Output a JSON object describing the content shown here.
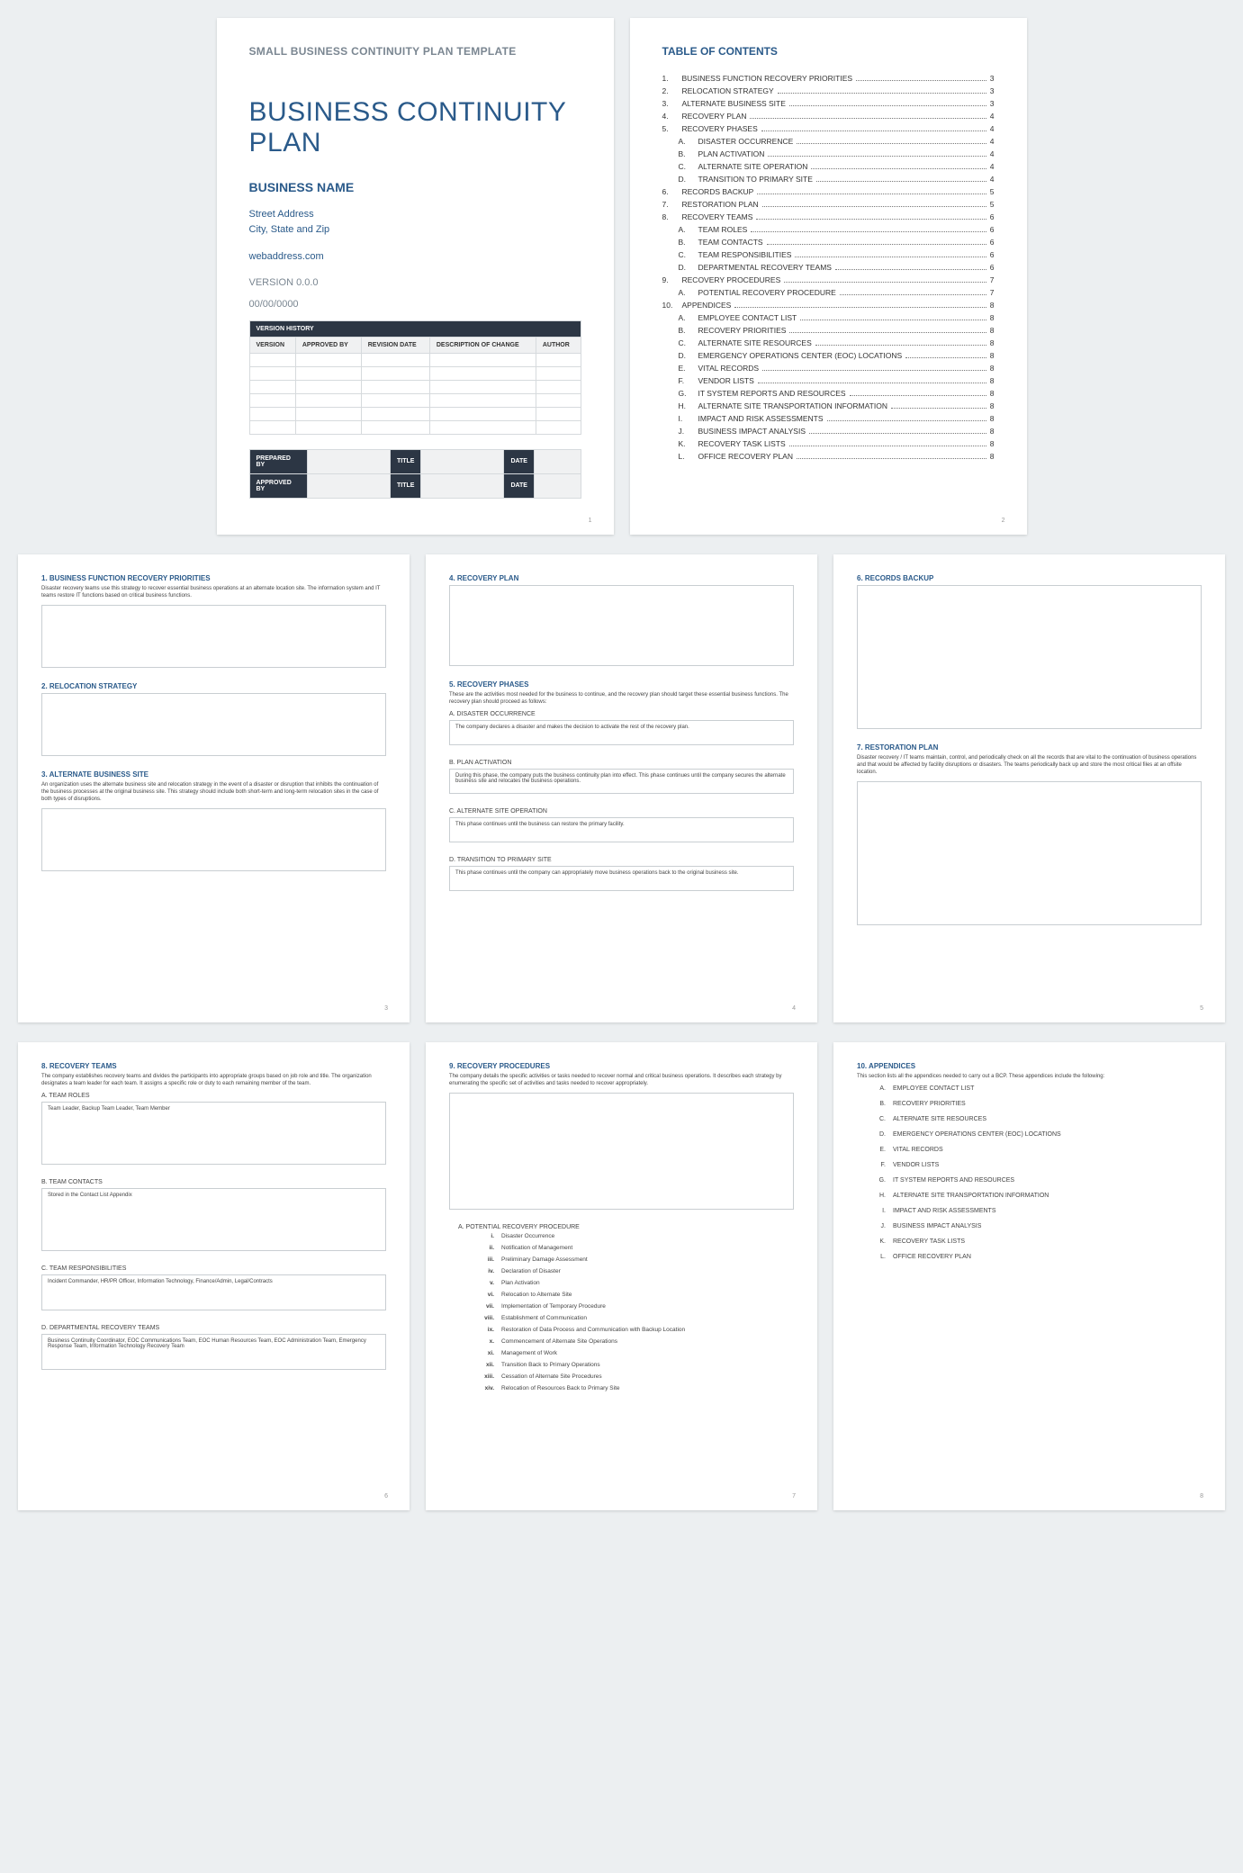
{
  "cover": {
    "subhead": "SMALL BUSINESS CONTINUITY PLAN TEMPLATE",
    "title": "BUSINESS CONTINUITY PLAN",
    "biz": "BUSINESS NAME",
    "street": "Street Address",
    "city": "City, State and Zip",
    "web": "webaddress.com",
    "version": "VERSION 0.0.0",
    "date": "00/00/0000",
    "vh_title": "VERSION HISTORY",
    "vh_cols": [
      "VERSION",
      "APPROVED BY",
      "REVISION DATE",
      "DESCRIPTION OF CHANGE",
      "AUTHOR"
    ],
    "sign": {
      "prepared": "PREPARED BY",
      "approved": "APPROVED BY",
      "title": "TITLE",
      "date": "DATE"
    },
    "pnum": "1"
  },
  "toc": {
    "title": "TABLE OF CONTENTS",
    "pnum": "2",
    "items": [
      {
        "i": "1.",
        "t": "BUSINESS FUNCTION RECOVERY PRIORITIES",
        "p": "3"
      },
      {
        "i": "2.",
        "t": "RELOCATION STRATEGY",
        "p": "3"
      },
      {
        "i": "3.",
        "t": "ALTERNATE BUSINESS SITE",
        "p": "3"
      },
      {
        "i": "4.",
        "t": "RECOVERY PLAN",
        "p": "4"
      },
      {
        "i": "5.",
        "t": "RECOVERY PHASES",
        "p": "4",
        "sub": [
          {
            "i": "A.",
            "t": "DISASTER OCCURRENCE",
            "p": "4"
          },
          {
            "i": "B.",
            "t": "PLAN ACTIVATION",
            "p": "4"
          },
          {
            "i": "C.",
            "t": "ALTERNATE SITE OPERATION",
            "p": "4"
          },
          {
            "i": "D.",
            "t": "TRANSITION TO PRIMARY SITE",
            "p": "4"
          }
        ]
      },
      {
        "i": "6.",
        "t": "RECORDS BACKUP",
        "p": "5"
      },
      {
        "i": "7.",
        "t": "RESTORATION PLAN",
        "p": "5"
      },
      {
        "i": "8.",
        "t": "RECOVERY TEAMS",
        "p": "6",
        "sub": [
          {
            "i": "A.",
            "t": "TEAM ROLES",
            "p": "6"
          },
          {
            "i": "B.",
            "t": "TEAM CONTACTS",
            "p": "6"
          },
          {
            "i": "C.",
            "t": "TEAM RESPONSIBILITIES",
            "p": "6"
          },
          {
            "i": "D.",
            "t": "DEPARTMENTAL RECOVERY TEAMS",
            "p": "6"
          }
        ]
      },
      {
        "i": "9.",
        "t": "RECOVERY PROCEDURES",
        "p": "7",
        "sub": [
          {
            "i": "A.",
            "t": "POTENTIAL RECOVERY PROCEDURE",
            "p": "7"
          }
        ]
      },
      {
        "i": "10.",
        "t": "APPENDICES",
        "p": "8",
        "sub": [
          {
            "i": "A.",
            "t": "EMPLOYEE CONTACT LIST",
            "p": "8"
          },
          {
            "i": "B.",
            "t": "RECOVERY PRIORITIES",
            "p": "8"
          },
          {
            "i": "C.",
            "t": "ALTERNATE SITE RESOURCES",
            "p": "8"
          },
          {
            "i": "D.",
            "t": "EMERGENCY OPERATIONS CENTER (EOC) LOCATIONS",
            "p": "8"
          },
          {
            "i": "E.",
            "t": "VITAL RECORDS",
            "p": "8"
          },
          {
            "i": "F.",
            "t": "VENDOR LISTS",
            "p": "8"
          },
          {
            "i": "G.",
            "t": "IT SYSTEM REPORTS AND RESOURCES",
            "p": "8"
          },
          {
            "i": "H.",
            "t": "ALTERNATE SITE TRANSPORTATION INFORMATION",
            "p": "8"
          },
          {
            "i": "I.",
            "t": "IMPACT AND RISK ASSESSMENTS",
            "p": "8"
          },
          {
            "i": "J.",
            "t": "BUSINESS IMPACT ANALYSIS",
            "p": "8"
          },
          {
            "i": "K.",
            "t": "RECOVERY TASK LISTS",
            "p": "8"
          },
          {
            "i": "L.",
            "t": "OFFICE RECOVERY PLAN",
            "p": "8"
          }
        ]
      }
    ]
  },
  "p3": {
    "s1": {
      "h": "1. BUSINESS FUNCTION RECOVERY PRIORITIES",
      "p": "Disaster recovery teams use this strategy to recover essential business operations at an alternate location site. The information system and IT teams restore IT functions based on critical business functions."
    },
    "s2": {
      "h": "2. RELOCATION STRATEGY"
    },
    "s3": {
      "h": "3. ALTERNATE BUSINESS SITE",
      "p": "An organization uses the alternate business site and relocation strategy in the event of a disaster or disruption that inhibits the continuation of the business processes at the original business site. This strategy should include both short-term and long-term relocation sites in the case of both types of disruptions."
    },
    "pnum": "3"
  },
  "p4": {
    "s4": {
      "h": "4. RECOVERY PLAN"
    },
    "s5": {
      "h": "5. RECOVERY PHASES",
      "p": "These are the activities most needed for the business to continue, and the recovery plan should target these essential business functions. The recovery plan should proceed as follows:"
    },
    "a": {
      "h": "A. DISASTER OCCURRENCE",
      "b": "The company declares a disaster and makes the decision to activate the rest of the recovery plan."
    },
    "b": {
      "h": "B. PLAN ACTIVATION",
      "b": "During this phase, the company puts the business continuity plan into effect. This phase continues until the company secures the alternate business site and relocates the business operations."
    },
    "c": {
      "h": "C. ALTERNATE SITE OPERATION",
      "b": "This phase continues until the business can restore the primary facility."
    },
    "d": {
      "h": "D. TRANSITION TO PRIMARY SITE",
      "b": "This phase continues until the company can appropriately move business operations back to the original business site."
    },
    "pnum": "4"
  },
  "p5": {
    "s6": {
      "h": "6. RECORDS BACKUP"
    },
    "s7": {
      "h": "7. RESTORATION PLAN",
      "p": "Disaster recovery / IT teams maintain, control, and periodically check on all the records that are vital to the continuation of business operations and that would be affected by facility disruptions or disasters. The teams periodically back up and store the most critical files at an offsite location."
    },
    "pnum": "5"
  },
  "p6": {
    "s8": {
      "h": "8. RECOVERY TEAMS",
      "p": "The company establishes recovery teams and divides the participants into appropriate groups based on job role and title. The organization designates a team leader for each team. It assigns a specific role or duty to each remaining member of the team."
    },
    "a": {
      "h": "A. TEAM ROLES",
      "b": "Team Leader, Backup Team Leader, Team Member"
    },
    "b": {
      "h": "B. TEAM CONTACTS",
      "b": "Stored in the Contact List Appendix"
    },
    "c": {
      "h": "C. TEAM RESPONSIBILITIES",
      "b": "Incident Commander, HR/PR Officer, Information Technology, Finance/Admin, Legal/Contracts"
    },
    "d": {
      "h": "D. DEPARTMENTAL RECOVERY TEAMS",
      "b": "Business Continuity Coordinator, EOC Communications Team, EOC Human Resources Team, EOC Administration Team, Emergency Response Team, Information Technology Recovery Team"
    },
    "pnum": "6"
  },
  "p7": {
    "s9": {
      "h": "9. RECOVERY PROCEDURES",
      "p": "The company details the specific activities or tasks needed to recover normal and critical business operations. It describes each strategy by enumerating the specific set of activities and tasks needed to recover appropriately."
    },
    "a": {
      "h": "A. POTENTIAL RECOVERY PROCEDURE"
    },
    "list": [
      {
        "i": "i.",
        "t": "Disaster Occurrence"
      },
      {
        "i": "ii.",
        "t": "Notification of Management"
      },
      {
        "i": "iii.",
        "t": "Preliminary Damage Assessment"
      },
      {
        "i": "iv.",
        "t": "Declaration of Disaster"
      },
      {
        "i": "v.",
        "t": "Plan Activation"
      },
      {
        "i": "vi.",
        "t": "Relocation to Alternate Site"
      },
      {
        "i": "vii.",
        "t": "Implementation of Temporary Procedure"
      },
      {
        "i": "viii.",
        "t": "Establishment of Communication"
      },
      {
        "i": "ix.",
        "t": "Restoration of Data Process and Communication with Backup Location"
      },
      {
        "i": "x.",
        "t": "Commencement of Alternate Site Operations"
      },
      {
        "i": "xi.",
        "t": "Management of Work"
      },
      {
        "i": "xii.",
        "t": "Transition Back to Primary Operations"
      },
      {
        "i": "xiii.",
        "t": "Cessation of Alternate Site Procedures"
      },
      {
        "i": "xiv.",
        "t": "Relocation of Resources Back to Primary Site"
      }
    ],
    "pnum": "7"
  },
  "p8": {
    "s10": {
      "h": "10.  APPENDICES",
      "p": "This section lists all the appendices needed to carry out a BCP. These appendices include the following:"
    },
    "list": [
      {
        "i": "A.",
        "t": "EMPLOYEE CONTACT LIST"
      },
      {
        "i": "B.",
        "t": "RECOVERY PRIORITIES"
      },
      {
        "i": "C.",
        "t": "ALTERNATE SITE RESOURCES"
      },
      {
        "i": "D.",
        "t": "EMERGENCY OPERATIONS CENTER (EOC) LOCATIONS"
      },
      {
        "i": "E.",
        "t": "VITAL RECORDS"
      },
      {
        "i": "F.",
        "t": "VENDOR LISTS"
      },
      {
        "i": "G.",
        "t": "IT SYSTEM REPORTS AND RESOURCES"
      },
      {
        "i": "H.",
        "t": "ALTERNATE SITE TRANSPORTATION INFORMATION"
      },
      {
        "i": "I.",
        "t": "IMPACT AND RISK ASSESSMENTS"
      },
      {
        "i": "J.",
        "t": "BUSINESS IMPACT ANALYSIS"
      },
      {
        "i": "K.",
        "t": "RECOVERY TASK LISTS"
      },
      {
        "i": "L.",
        "t": "OFFICE RECOVERY PLAN"
      }
    ],
    "pnum": "8"
  }
}
